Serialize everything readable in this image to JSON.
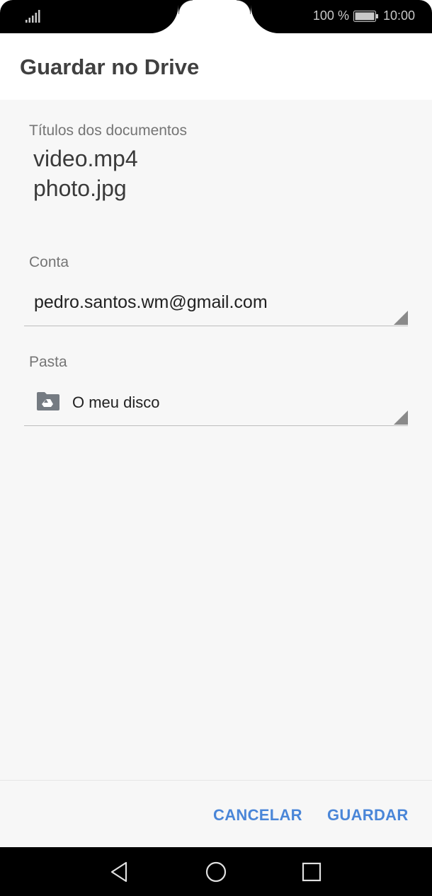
{
  "status": {
    "battery_percent": "100 %",
    "time": "10:00",
    "icons": [
      "signal-icon",
      "battery-icon"
    ]
  },
  "dialog": {
    "title": "Guardar no Drive",
    "documents_label": "Títulos dos documentos",
    "documents": [
      "video.mp4",
      "photo.jpg"
    ],
    "account_label": "Conta",
    "account_value": "pedro.santos.wm@gmail.com",
    "folder_label": "Pasta",
    "folder_value": "O meu disco",
    "folder_icon": "drive-folder-icon"
  },
  "actions": {
    "cancel_label": "CANCELAR",
    "save_label": "GUARDAR"
  },
  "navbar": {
    "icons": [
      "back-icon",
      "home-icon",
      "recents-icon"
    ]
  },
  "colors": {
    "accent": "#4a86d8",
    "background": "#f7f7f7",
    "title_text": "#404040"
  }
}
